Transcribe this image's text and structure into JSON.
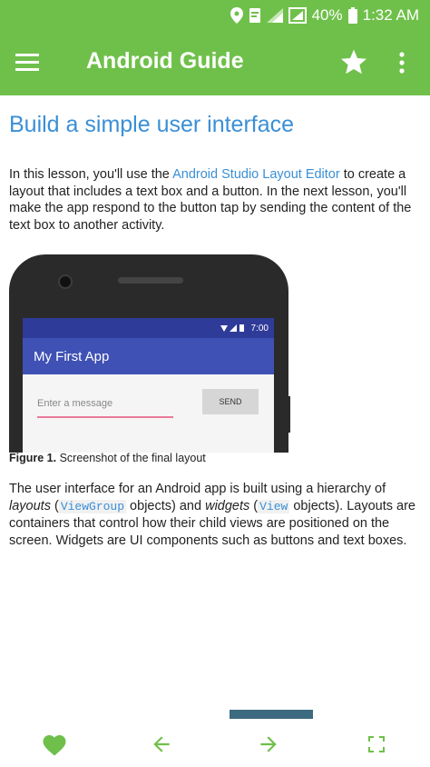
{
  "status_bar": {
    "battery": "40%",
    "time": "1:32 AM"
  },
  "app_bar": {
    "title": "Android Guide"
  },
  "article": {
    "title": "Build a simple user interface",
    "intro_prefix": "In this lesson, you'll use the ",
    "intro_link": "Android Studio Layout Editor",
    "intro_suffix": " to create a layout that includes a text box and a button. In the next lesson, you'll make the app respond to the button tap by sending the content of the text box to another activity.",
    "figure": {
      "app_name": "My First App",
      "phone_time": "7:00",
      "input_placeholder": "Enter a message",
      "send_label": "SEND",
      "caption_label": "Figure 1.",
      "caption_text": " Screenshot of the final layout"
    },
    "body_p1": "The user interface for an Android app is built using a hierarchy of ",
    "body_layouts": "layouts",
    "body_p2": " (",
    "body_code1": "ViewGroup",
    "body_p3": " objects) and ",
    "body_widgets": "widgets",
    "body_p4": " (",
    "body_code2": "View",
    "body_p5": " objects). Layouts are containers that control how their child views are positioned on the screen. Widgets are UI components such as buttons and text boxes."
  },
  "colors": {
    "app_bar": "#6fc04a",
    "link": "#3a8fd6",
    "nav_icon": "#6fc04a"
  },
  "bottom_nav": [
    "heart-icon",
    "arrow-left-icon",
    "arrow-right-icon",
    "fullscreen-icon"
  ]
}
